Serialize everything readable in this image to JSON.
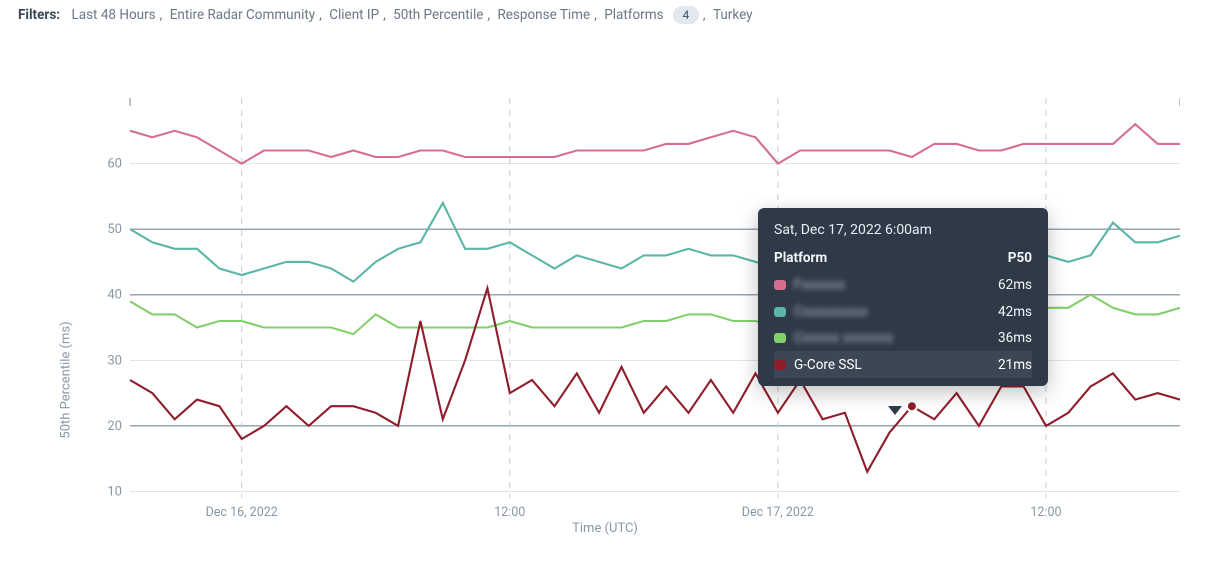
{
  "filters": {
    "label": "Filters:",
    "items": [
      "Last 48 Hours",
      "Entire Radar Community",
      "Client IP",
      "50th Percentile",
      "Response Time"
    ],
    "platforms_label": "Platforms",
    "platforms_count": "4",
    "country": "Turkey"
  },
  "axis": {
    "ylabel": "50th Percentile (ms)",
    "xlabel": "Time (UTC)",
    "xticks": [
      "Dec 16, 2022",
      "12:00",
      "Dec 17, 2022",
      "12:00"
    ]
  },
  "colors": {
    "s0": "#d76f8c",
    "s1": "#5bb6a7",
    "s2": "#83cf6c",
    "s3": "#8f1d2c"
  },
  "tooltip": {
    "datetime": "Sat, Dec 17, 2022 6:00am",
    "head_platform": "Platform",
    "head_value": "P50",
    "rows": [
      {
        "platform": "Fxxxxxx",
        "value": "62ms",
        "obscured": true
      },
      {
        "platform": "Cxxxxxxxxx",
        "value": "42ms",
        "obscured": true
      },
      {
        "platform": "Cxxxxx xxxxxxx",
        "value": "36ms",
        "obscured": true
      },
      {
        "platform": "G-Core SSL",
        "value": "21ms",
        "highlight": true
      }
    ]
  },
  "chart_data": {
    "type": "line",
    "xlabel": "Time (UTC)",
    "ylabel": "50th Percentile (ms)",
    "ylim": [
      9,
      70
    ],
    "x": [
      0,
      1,
      2,
      3,
      4,
      5,
      6,
      7,
      8,
      9,
      10,
      11,
      12,
      13,
      14,
      15,
      16,
      17,
      18,
      19,
      20,
      21,
      22,
      23,
      24,
      25,
      26,
      27,
      28,
      29,
      30,
      31,
      32,
      33,
      34,
      35,
      36,
      37,
      38,
      39,
      40,
      41,
      42,
      43,
      44,
      45,
      46,
      47
    ],
    "x_tick_labels": {
      "5": "Dec 16, 2022",
      "17": "12:00",
      "29": "Dec 17, 2022",
      "41": "12:00"
    },
    "series": [
      {
        "name": "Fxxxxxx",
        "color": "#d76f8c",
        "values": [
          65,
          64,
          65,
          64,
          62,
          60,
          62,
          62,
          62,
          61,
          62,
          61,
          61,
          62,
          62,
          61,
          61,
          61,
          61,
          61,
          62,
          62,
          62,
          62,
          63,
          63,
          64,
          65,
          64,
          60,
          62,
          62,
          62,
          62,
          62,
          61,
          63,
          63,
          62,
          62,
          63,
          63,
          63,
          63,
          63,
          66,
          63,
          63
        ]
      },
      {
        "name": "Cxxxxxxxxx",
        "color": "#5bb6a7",
        "values": [
          50,
          48,
          47,
          47,
          44,
          43,
          44,
          45,
          45,
          44,
          42,
          45,
          47,
          48,
          54,
          47,
          47,
          48,
          46,
          44,
          46,
          45,
          44,
          46,
          46,
          47,
          46,
          46,
          45,
          44,
          46,
          45,
          45,
          46,
          44,
          46,
          45,
          46,
          43,
          45,
          43,
          46,
          45,
          46,
          51,
          48,
          48,
          49
        ]
      },
      {
        "name": "Cxxxxx xxxxxxx",
        "color": "#83cf6c",
        "values": [
          39,
          37,
          37,
          35,
          36,
          36,
          35,
          35,
          35,
          35,
          34,
          37,
          35,
          35,
          35,
          35,
          35,
          36,
          35,
          35,
          35,
          35,
          35,
          36,
          36,
          37,
          37,
          36,
          36,
          35,
          35,
          36,
          36,
          35,
          35,
          35,
          35,
          35,
          37,
          36,
          36,
          38,
          38,
          40,
          38,
          37,
          37,
          38
        ]
      },
      {
        "name": "G-Core SSL",
        "color": "#8f1d2c",
        "values": [
          27,
          25,
          21,
          24,
          23,
          18,
          20,
          23,
          20,
          23,
          23,
          22,
          20,
          36,
          21,
          30,
          41,
          25,
          27,
          23,
          28,
          22,
          29,
          22,
          26,
          22,
          27,
          22,
          28,
          22,
          27,
          21,
          22,
          13,
          19,
          23,
          21,
          25,
          20,
          26,
          26,
          20,
          22,
          26,
          28,
          24,
          25,
          24
        ]
      }
    ]
  }
}
